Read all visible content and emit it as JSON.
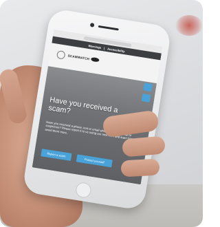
{
  "site": {
    "nav_items": [
      "Warnings",
      "Accessibility"
    ],
    "brand": "SCAMWATCH",
    "headline": "Have you received a scam?",
    "body": "Have you received a phone, text or email which seems unusual or suspicious? Please report it to us using our new form and learn how to avoid them more.",
    "cta_primary": "Report a scam",
    "cta_secondary": "Protect yourself"
  },
  "colors": {
    "accent": "#4aa3d8",
    "nav_bg": "#3c3e41",
    "hero_bg": "#6f7175",
    "phone_body": "#efefef"
  }
}
